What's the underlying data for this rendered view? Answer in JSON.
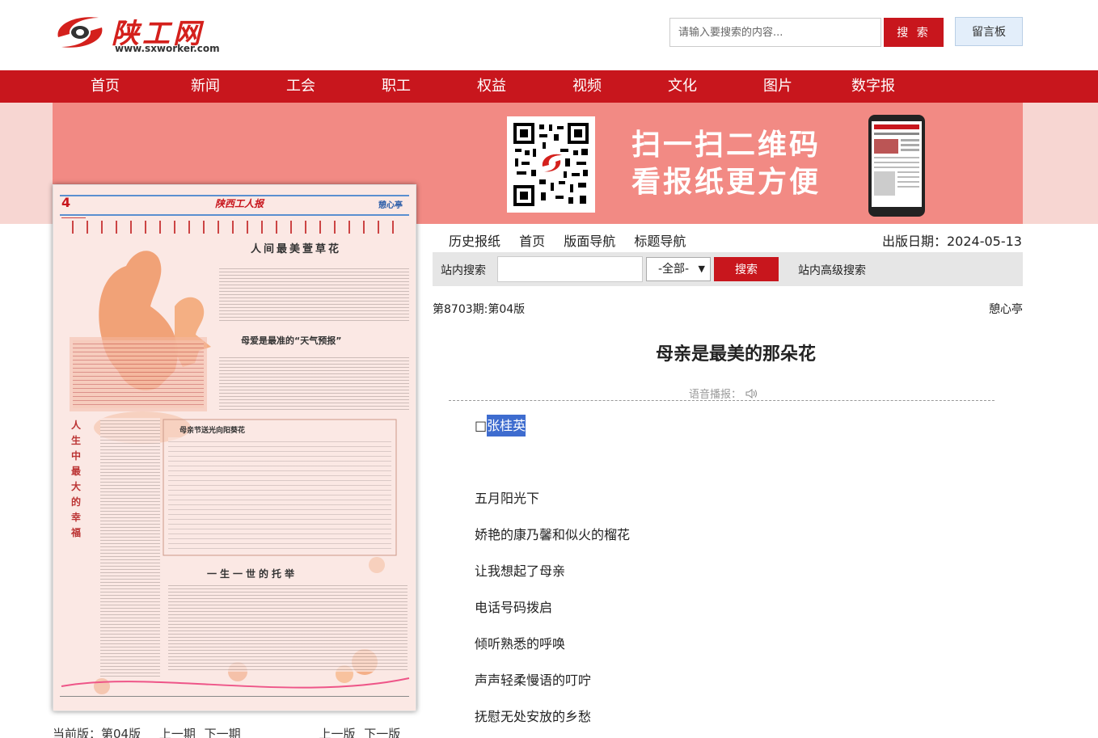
{
  "header": {
    "logo_text": "陕工网",
    "logo_url": "www.sxworker.com",
    "search_placeholder": "请输入要搜索的内容...",
    "search_button": "搜 索",
    "message_board": "留言板"
  },
  "nav": {
    "items": [
      "首页",
      "新闻",
      "工会",
      "职工",
      "权益",
      "视频",
      "文化",
      "图片",
      "数字报"
    ]
  },
  "banner": {
    "line1": "扫一扫二维码",
    "line2": "看报纸更方便"
  },
  "newspaper": {
    "page_no": "4",
    "masthead": "陕西工人报",
    "section": "憩心亭",
    "headline1": "人间最美萱草花",
    "headline2": "母爱是最准的“天气预报”",
    "headline3": "一生一世的托举",
    "side_title": "人生中最大的幸福",
    "poem_box_title": "母亲节送光向阳葵花"
  },
  "bottom_nav": {
    "current": "当前版：第04版",
    "prev_issue": "上一期",
    "next_issue": "下一期",
    "prev_page": "上一版",
    "next_page": "下一版"
  },
  "subnav": {
    "items": [
      "历史报纸",
      "首页",
      "版面导航",
      "标题导航"
    ],
    "pub_date": "出版日期：2024-05-13"
  },
  "site_search": {
    "label": "站内搜索",
    "select_value": "-全部-",
    "button": "搜索",
    "advanced": "站内高级搜索"
  },
  "article": {
    "issue": "第8703期:第04版",
    "column": "憩心亭",
    "title": "母亲是最美的那朵花",
    "voice_label": "语音播报：",
    "author_prefix": "□",
    "author": "张桂英",
    "lines": [
      "五月阳光下",
      "娇艳的康乃馨和似火的榴花",
      "让我想起了母亲",
      "电话号码拨启",
      "倾听熟悉的呼唤",
      "声声轻柔慢语的叮咛",
      "抚慰无处安放的乡愁"
    ]
  },
  "colors": {
    "brand_red": "#c8161d",
    "banner_pink": "#f28a84",
    "banner_bg": "#f7d6d2",
    "selection_blue": "#3e6ccf"
  }
}
